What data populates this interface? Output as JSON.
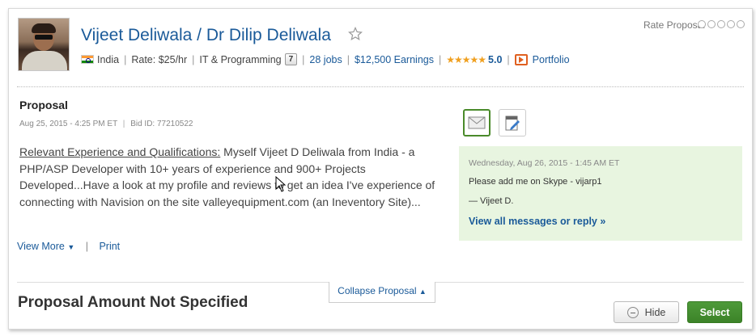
{
  "header": {
    "name": "Vijeet Deliwala / Dr Dilip Deliwala",
    "rate_proposal_label": "Rate Proposal",
    "meta": {
      "country": "India",
      "rate": "Rate: $25/hr",
      "category": "IT & Programming",
      "category_badge": "7",
      "jobs": "28 jobs",
      "earnings": "$12,500 Earnings",
      "rating": "5.0",
      "portfolio": "Portfolio"
    }
  },
  "proposal": {
    "title": "Proposal",
    "date": "Aug 25, 2015 - 4:25 PM ET",
    "bid_id": "Bid ID: 77210522",
    "body_heading": "Relevant Experience and Qualifications:",
    "body_text": " Myself Vijeet D Deliwala from India - a PHP/ASP Developer with 10+ years of experience and 900+ Projects Developed...Have a look at my profile and reviews to get an idea I've experience of connecting with Navision on the site valleyequipment.com (an Ineventory Site)...",
    "view_more": "View More",
    "print": "Print"
  },
  "message": {
    "date": "Wednesday, Aug 26, 2015 - 1:45 AM ET",
    "text": "Please add me on Skype - vijarp1",
    "signature": "— Vijeet D.",
    "link": "View all messages or reply »"
  },
  "footer": {
    "collapse": "Collapse Proposal",
    "amount": "Proposal Amount Not Specified",
    "hide": "Hide",
    "select": "Select"
  },
  "colors": {
    "link": "#1a5a99",
    "select_button": "#3c8328",
    "message_bg": "#e8f5e0"
  }
}
